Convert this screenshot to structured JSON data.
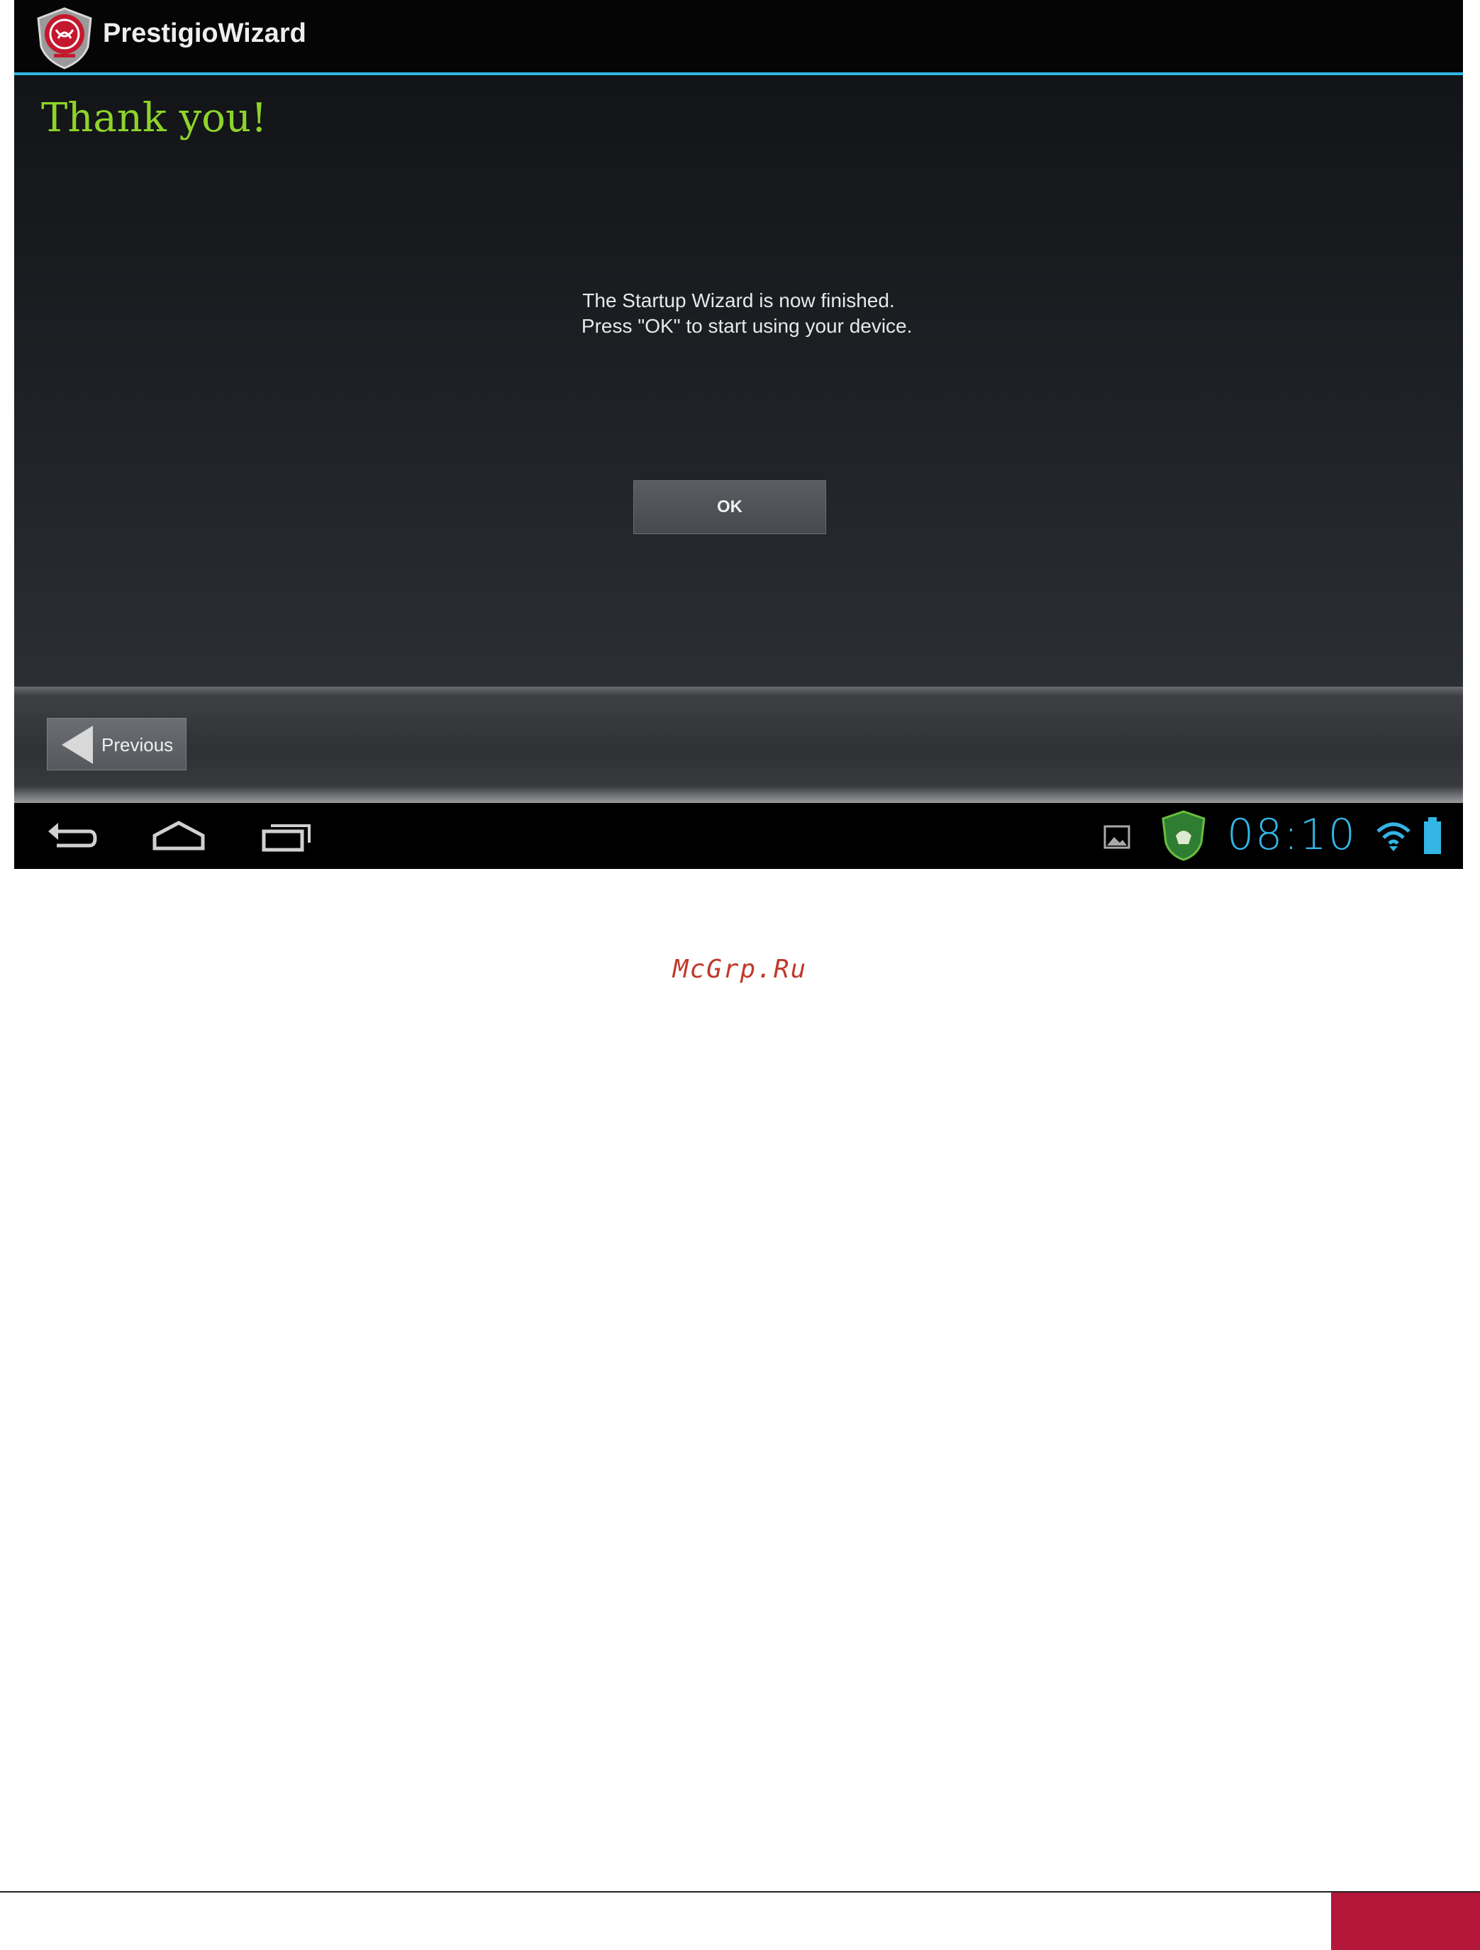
{
  "app": {
    "title": "PrestigioWizard"
  },
  "wizard": {
    "heading": "Thank you!",
    "message_line1": "The Startup Wizard is now finished.",
    "message_line2": "   Press \"OK\" to start using your device.",
    "ok_label": "OK",
    "previous_label": "Previous"
  },
  "statusbar": {
    "time": "08:10",
    "icons": [
      "gallery-icon",
      "shield-icon",
      "wifi-icon",
      "battery-icon"
    ]
  },
  "navbar": {
    "icons": [
      "back-icon",
      "home-icon",
      "recent-apps-icon"
    ]
  },
  "page": {
    "watermark": "McGrp.Ru"
  },
  "colors": {
    "accent_blue": "#33b5e5",
    "heading_green": "#8ed42a",
    "brand_red": "#b5173a",
    "watermark_red": "#c0392b"
  }
}
